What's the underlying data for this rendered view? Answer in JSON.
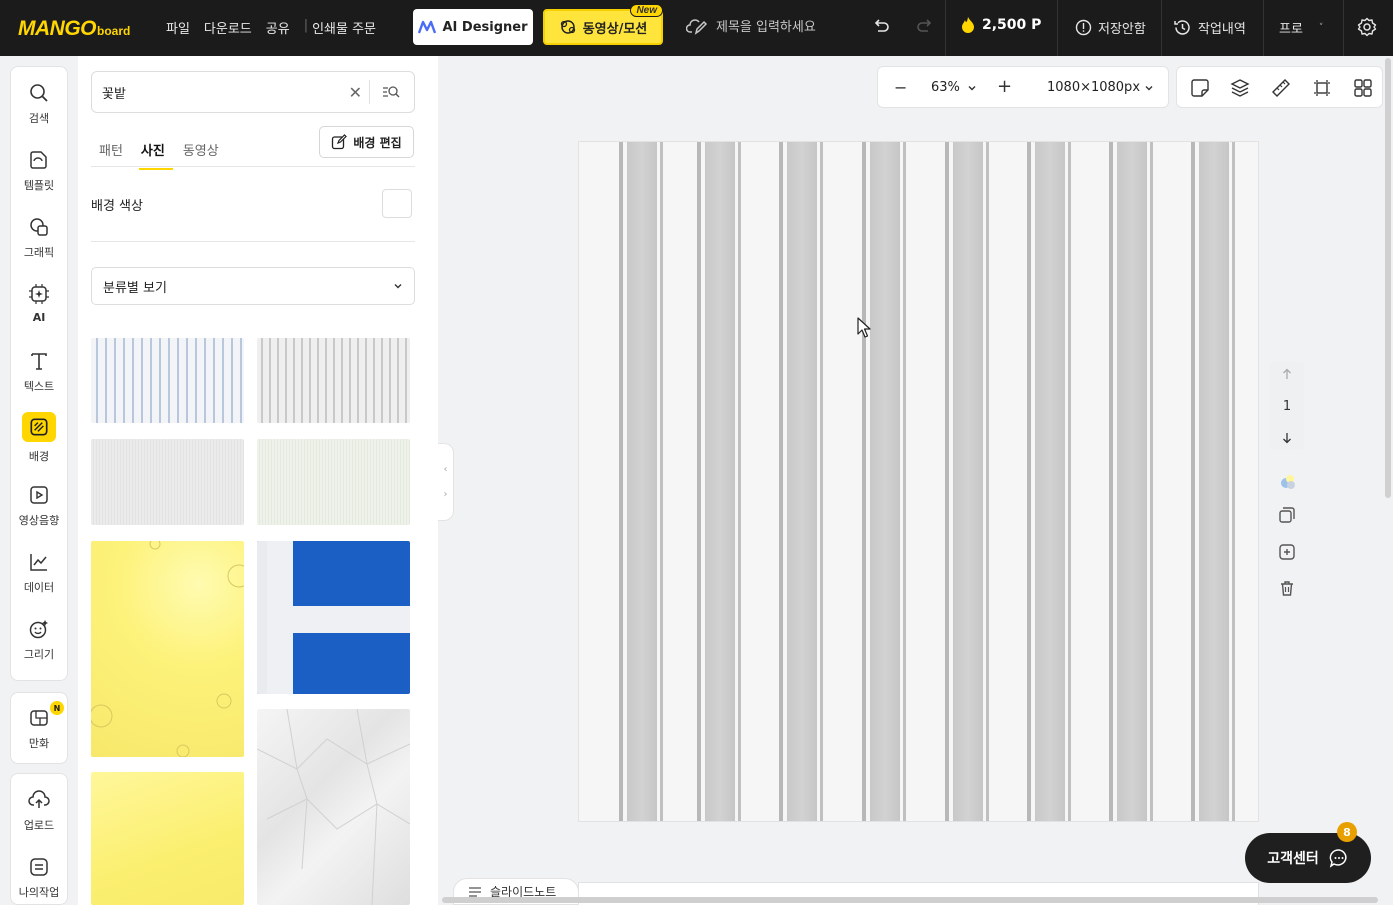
{
  "brand": {
    "name_main": "MANGO",
    "name_sub": "board"
  },
  "menu": {
    "file": "파일",
    "download": "다운로드",
    "share": "공유",
    "print": "인쇄물 주문"
  },
  "header": {
    "ai_designer": "AI Designer",
    "motion": "동영상/모션",
    "new_badge": "New",
    "title_placeholder": "제목을 입력하세요",
    "points": "2,500 P",
    "save_status": "저장안함",
    "history": "작업내역",
    "pro": "프로"
  },
  "rail": {
    "search": "검색",
    "template": "템플릿",
    "graphic": "그래픽",
    "ai": "AI",
    "text": "텍스트",
    "background": "배경",
    "media": "영상음향",
    "data": "데이터",
    "draw": "그리기",
    "comic": "만화",
    "comic_badge": "N",
    "upload": "업로드",
    "mywork": "나의작업"
  },
  "panel": {
    "search_value": "꽃밭",
    "tabs": [
      "패턴",
      "사진",
      "동영상"
    ],
    "active_tab": "사진",
    "edit_bg": "배경 편집",
    "bg_color_label": "배경 색상",
    "bg_color": "#ffffff",
    "category_select": "분류별 보기"
  },
  "canvas": {
    "zoom": "63%",
    "size": "1080×1080px",
    "page_number": "1"
  },
  "footer": {
    "slide_note": "슬라이드노트",
    "customer_center": "고객센터",
    "cs_badge": "8"
  },
  "colors": {
    "accent": "#ffd600",
    "topbar": "#1b1b1b"
  }
}
